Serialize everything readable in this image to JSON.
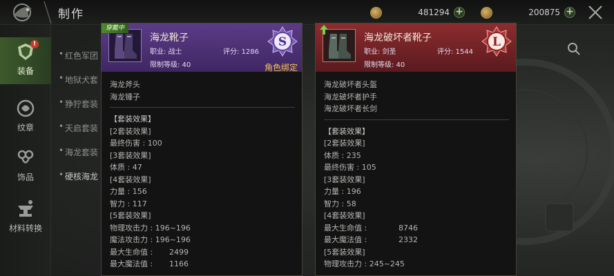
{
  "header": {
    "title": "制作",
    "currency1": {
      "icon": "gold-coin-icon",
      "value": "481294"
    },
    "currency2": {
      "icon": "gold-coin-icon",
      "value": "200875"
    }
  },
  "sidebar": {
    "tabs": [
      {
        "label": "装备",
        "icon": "armor-icon",
        "active": true,
        "badge": "!"
      },
      {
        "label": "纹章",
        "icon": "crest-icon",
        "active": false
      },
      {
        "label": "饰品",
        "icon": "accessory-icon",
        "active": false
      },
      {
        "label": "材料转换",
        "icon": "anvil-icon",
        "active": false
      }
    ]
  },
  "list": {
    "items": [
      {
        "label": "红色军团",
        "active": false
      },
      {
        "label": "地狱犬套",
        "active": false
      },
      {
        "label": "狰狞套装",
        "active": false
      },
      {
        "label": "天启套装",
        "active": false
      },
      {
        "label": "海龙套装",
        "active": false
      },
      {
        "label": "硬核海龙",
        "active": true
      }
    ]
  },
  "card_left": {
    "equipped_tag": "穿戴中",
    "name": "海龙靴子",
    "job": "职业: 战士",
    "score": "评分: 1286",
    "level": "限制等级: 40",
    "grade": "S",
    "bind": "角色绑定",
    "set_pieces": [
      "海龙斧头",
      "海龙锤子"
    ],
    "set_effect_title": "【套装效果】",
    "effects": [
      {
        "k": "[2套装效果]",
        "v": ""
      },
      {
        "k": "最终伤害 : 100",
        "v": ""
      },
      {
        "k": "[3套装效果]",
        "v": ""
      },
      {
        "k": "体质 : 47",
        "v": ""
      },
      {
        "k": "[4套装效果]",
        "v": ""
      },
      {
        "k": "力量 : 156",
        "v": ""
      },
      {
        "k": "智力 : 117",
        "v": ""
      },
      {
        "k": "[5套装效果]",
        "v": ""
      },
      {
        "k": "物理攻击力 : 196~196",
        "v": ""
      },
      {
        "k": "魔法攻击力 : 196~196",
        "v": ""
      },
      {
        "k": "最大生命值 :",
        "v": "2499"
      },
      {
        "k": "最大魔法值 :",
        "v": "1166"
      }
    ]
  },
  "card_right": {
    "name": "海龙破坏者靴子",
    "job": "职业: 剑圣",
    "score": "评分: 1544",
    "level": "限制等级: 40",
    "grade": "L",
    "set_pieces": [
      "海龙破坏者头盔",
      "海龙破坏者护手",
      "海龙破坏者长剑"
    ],
    "set_effect_title": "【套装效果】",
    "effects": [
      {
        "k": "[2套装效果]",
        "v": ""
      },
      {
        "k": "体质 : 235",
        "v": ""
      },
      {
        "k": "最终伤害 : 105",
        "v": ""
      },
      {
        "k": "[3套装效果]",
        "v": ""
      },
      {
        "k": "力量 : 196",
        "v": ""
      },
      {
        "k": "智力 : 58",
        "v": ""
      },
      {
        "k": "[4套装效果]",
        "v": ""
      },
      {
        "k": "最大生命值 :",
        "v": "8746"
      },
      {
        "k": "最大魔法值 :",
        "v": "2332"
      },
      {
        "k": "[5套装效果]",
        "v": ""
      },
      {
        "k": "物理攻击力 : 245~245",
        "v": ""
      }
    ]
  }
}
